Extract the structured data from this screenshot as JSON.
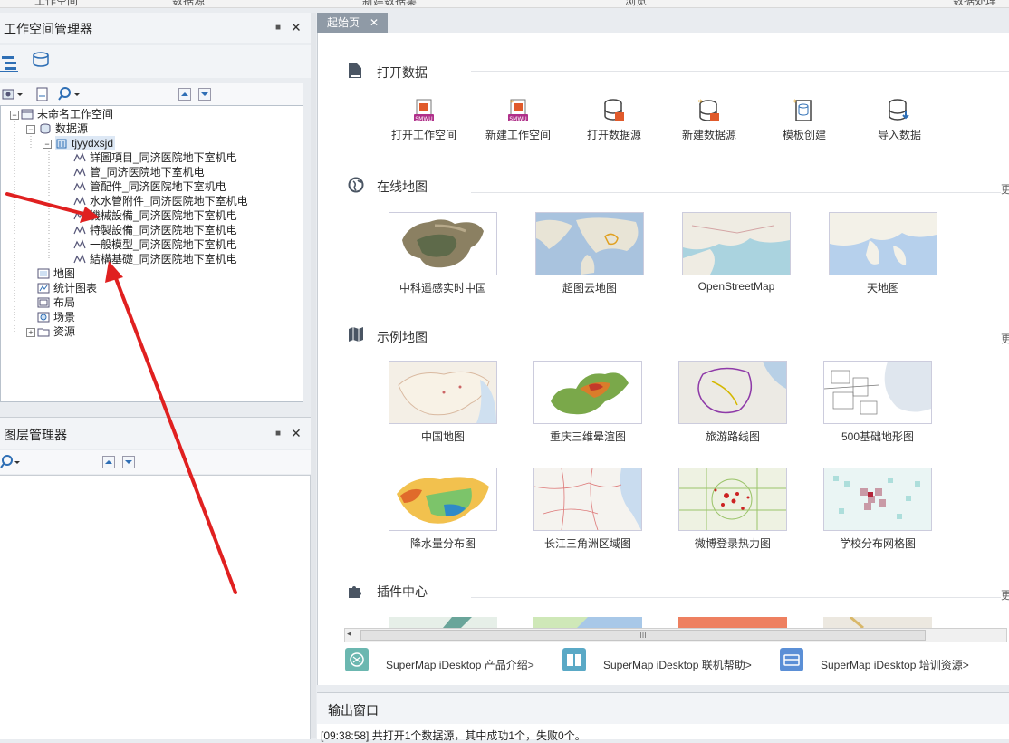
{
  "ribbon": {
    "labels": [
      "工作空间",
      "数据源",
      "新建数据集",
      "浏览",
      "数据处理"
    ]
  },
  "workspace_panel": {
    "title": "工作空间管理器",
    "tree": {
      "root": "未命名工作空间",
      "datasources": "数据源",
      "datasource_name": "tjyydxsjd",
      "datasets": [
        "詳圖項目_同济医院地下室机电",
        "管_同济医院地下室机电",
        "管配件_同济医院地下室机电",
        "水水管附件_同济医院地下室机电",
        "機械設備_同济医院地下室机电",
        "特製設備_同济医院地下室机电",
        "一般模型_同济医院地下室机电",
        "結構基礎_同济医院地下室机电"
      ],
      "maps": "地图",
      "charts": "统计图表",
      "layouts": "布局",
      "scenes": "场景",
      "resources": "资源"
    }
  },
  "layer_panel": {
    "title": "图层管理器"
  },
  "tab": {
    "label": "起始页"
  },
  "start_page": {
    "open_data": {
      "title": "打开数据",
      "actions": [
        "打开工作空间",
        "新建工作空间",
        "打开数据源",
        "新建数据源",
        "模板创建",
        "导入数据"
      ]
    },
    "online_maps": {
      "title": "在线地图",
      "more": "更",
      "items": [
        "中科遥感实时中国",
        "超图云地图",
        "OpenStreetMap",
        "天地图"
      ]
    },
    "sample_maps": {
      "title": "示例地图",
      "more": "更",
      "items": [
        "中国地图",
        "重庆三维晕渲图",
        "旅游路线图",
        "500基础地形图",
        "降水量分布图",
        "长江三角洲区域图",
        "微博登录热力图",
        "学校分布网格图"
      ]
    },
    "plugins": {
      "title": "插件中心",
      "more": "更"
    },
    "scroll_grip": "III",
    "links": [
      "SuperMap iDesktop 产品介绍>",
      "SuperMap iDesktop 联机帮助>",
      "SuperMap iDesktop 培训资源>"
    ]
  },
  "output": {
    "title": "输出窗口",
    "log": "[09:38:58] 共打开1个数据源，其中成功1个，失败0个。"
  },
  "colors": {
    "annotation_arrow": "#e02020",
    "tab_bg": "#8f9aa6",
    "accent": "#2f6fb5"
  }
}
